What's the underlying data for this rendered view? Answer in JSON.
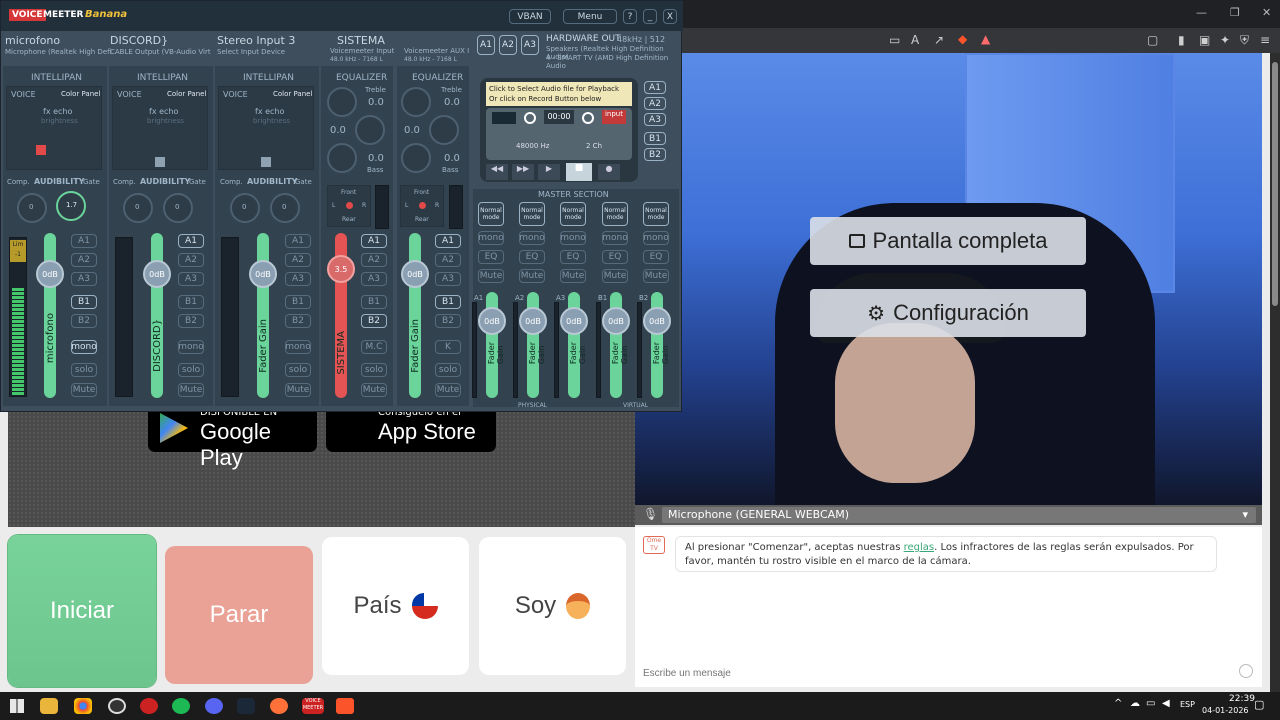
{
  "voicemeeter": {
    "logo_voice": "VOICE",
    "logo_meeter": "MEETER",
    "logo_edition": "Banana",
    "vban_label": "VBAN",
    "menu_label": "Menu",
    "help_label": "?",
    "minimize_label": "_",
    "close_label": "X",
    "hardware_out": "HARDWARE OUT",
    "hardware_rate": "48kHz | 512",
    "hardware_dev1": "Speakers (Realtek High Definition Audio)",
    "hardware_dev2": "4 - SMART TV (AMD High Definition Audio",
    "inputs": [
      {
        "name": "microfono",
        "device": "Microphone (Realtek High Defi",
        "fader": "0dB",
        "label": "microfono"
      },
      {
        "name": "DISCORD}",
        "device": "CABLE Output (VB-Audio Virt",
        "fader": "0dB",
        "label": "DISCORD}"
      },
      {
        "name": "Stereo Input 3",
        "device": "Select Input Device",
        "fader": "0dB",
        "label": "Fader Gain"
      }
    ],
    "virtual_inputs": [
      {
        "name": "SISTEMA",
        "device": "Voicemeeter Input",
        "rate": "48.0 kHz - 7168 L",
        "fader": "3.5",
        "label": "SISTEMA"
      },
      {
        "name": "Voicemeeter AUX I",
        "device": "",
        "rate": "48.0 kHz - 7168 L",
        "fader": "0dB",
        "label": "Fader Gain"
      }
    ],
    "intellipan": "INTELLIPAN",
    "voice": "VOICE",
    "color_panel": "Color Panel",
    "fx_echo": "fx echo",
    "brightness": "brightness",
    "comp": "Comp.",
    "audibility": "AUDIBILITY",
    "gate": "Gate",
    "equalizer": "EQUALIZER",
    "treble": "Treble",
    "bass": "Bass",
    "eq_value": "0.0",
    "bus_buttons": [
      "A1",
      "A2",
      "A3",
      "B1",
      "B2"
    ],
    "mono": "mono",
    "solo": "solo",
    "mute": "Mute",
    "mc": "M.C",
    "k": "K",
    "knob_gate_1": "1.7",
    "knob_zero": "0",
    "lim": "Lim",
    "lim_val": "-1",
    "player_line1": "Click to Select Audio file for Playback",
    "player_line2": "Or click on Record Button below",
    "player_time": "00:00",
    "player_input": "input",
    "player_hz": "48000 Hz",
    "player_ch": "2 Ch",
    "master_section": "MASTER SECTION",
    "normal_mode": "Normal mode",
    "master_buttons": [
      "mono",
      "EQ",
      "Mute"
    ],
    "master_buses": [
      {
        "name": "A1",
        "fader": "0dB"
      },
      {
        "name": "A2",
        "fader": "0dB"
      },
      {
        "name": "A3",
        "fader": "0dB"
      },
      {
        "name": "B1",
        "fader": "0dB"
      },
      {
        "name": "B2",
        "fader": "0dB"
      }
    ],
    "fader_gain": "Fader Gain",
    "physical": "PHYSICAL",
    "virtual": "VIRTUAL",
    "front": "Front",
    "rear": "Rear",
    "l": "L",
    "r": "R"
  },
  "page": {
    "google_small": "DISPONIBLE EN",
    "google_big": "Google Play",
    "apple_small": "Consíguelo en el",
    "apple_big": "App Store",
    "start_label": "Iniciar",
    "stop_label": "Parar",
    "country_label": "País",
    "gender_label": "Soy",
    "fullscreen_label": "Pantalla completa",
    "settings_label": "Configuración",
    "mic_select": "Microphone (GENERAL WEBCAM)",
    "chat_msg_1": "Al presionar \"Comenzar\", aceptas nuestras ",
    "chat_link": "reglas",
    "chat_msg_2": ". Los infractores de las reglas serán expulsados. Por favor, mantén tu rostro visible en el marco de la cámara.",
    "chat_placeholder": "Escribe un mensaje"
  },
  "taskbar": {
    "lang": "ESP",
    "time": "22:39",
    "date": "04-01-2026"
  }
}
